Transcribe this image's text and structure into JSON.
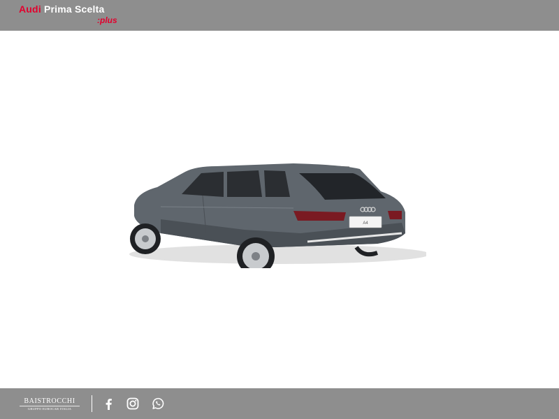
{
  "header": {
    "logo_brand": "Audi",
    "logo_text": "Prima Scelta",
    "logo_suffix": ":plus"
  },
  "car": {
    "badge": "A4"
  },
  "footer": {
    "dealer_name": "BAISTROCCHI",
    "dealer_subtitle": "GRUPPO EUROCAR ITALIA",
    "social_icons": [
      "facebook-icon",
      "instagram-icon",
      "whatsapp-icon"
    ]
  },
  "colors": {
    "bar_background": "#8e8e8e",
    "brand_red": "#e2002d",
    "page_background": "#ffffff"
  }
}
